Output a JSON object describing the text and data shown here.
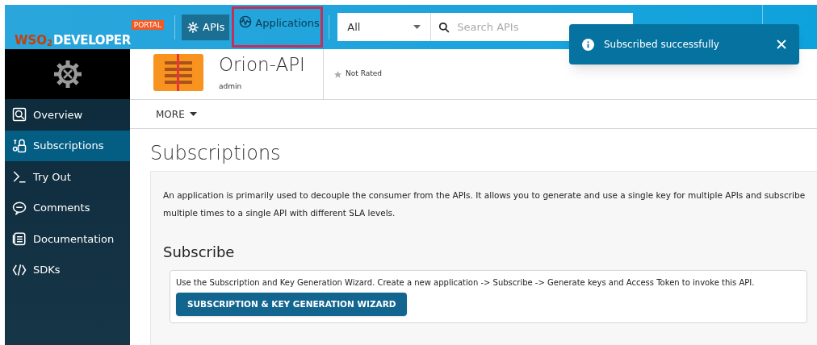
{
  "header": {
    "logo": {
      "brand": "WSO",
      "subscript": "2",
      "product": "DEVELOPER",
      "badge": "PORTAL"
    },
    "nav": [
      {
        "label": "APIs",
        "kind": "gear",
        "selected": true,
        "highlighted": false
      },
      {
        "label": "Applications",
        "kind": "wave",
        "selected": false,
        "highlighted": true
      }
    ],
    "search": {
      "scope": "All",
      "placeholder": "Search APIs"
    }
  },
  "toast": {
    "message": "Subscribed successfully"
  },
  "sidebar": {
    "items": [
      {
        "label": "Overview",
        "kind": "overview",
        "selected": false
      },
      {
        "label": "Subscriptions",
        "kind": "subscriptions",
        "selected": true
      },
      {
        "label": "Try Out",
        "kind": "terminal",
        "selected": false
      },
      {
        "label": "Comments",
        "kind": "comment",
        "selected": false
      },
      {
        "label": "Documentation",
        "kind": "doc",
        "selected": false
      },
      {
        "label": "SDKs",
        "kind": "code",
        "selected": false
      }
    ]
  },
  "api": {
    "name": "Orion-API",
    "owner": "admin",
    "rating": "Not Rated",
    "more": "MORE"
  },
  "page": {
    "title": "Subscriptions",
    "description": "An application is primarily used to decouple the consumer from the APIs. It allows you to generate and use a single key for multiple APIs and subscribe multiple times to a single API with different SLA levels.",
    "subscribe": {
      "title": "Subscribe",
      "text": "Use the Subscription and Key Generation Wizard. Create a new application -> Subscribe -> Generate keys and Access Token to invoke this API.",
      "button": "SUBSCRIPTION & KEY GENERATION WIZARD"
    }
  }
}
